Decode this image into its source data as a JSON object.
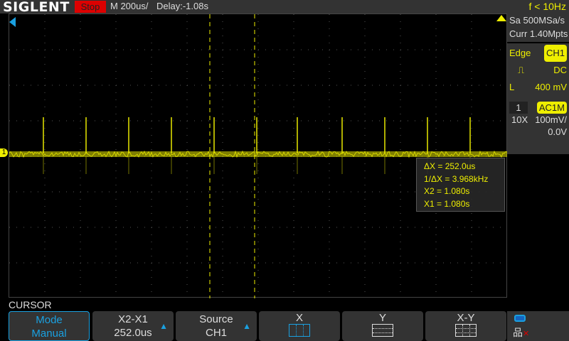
{
  "header": {
    "logo": "SIGLENT",
    "status": "Stop",
    "timebase": "M 200us/",
    "delay": "Delay:-1.08s",
    "trigger_freq": "f < 10Hz"
  },
  "acquisition": {
    "sample_rate": "Sa 500MSa/s",
    "memory": "Curr 1.40Mpts"
  },
  "trigger": {
    "type": "Edge",
    "source": "CH1",
    "coupling": "DC",
    "level_label": "L",
    "level": "400 mV"
  },
  "channel": {
    "number": "1",
    "coupling": "AC1M",
    "probe": "10X",
    "scale": "100mV/",
    "offset": "0.0V"
  },
  "measurement": {
    "delta_x": "ΔX = 252.0us",
    "inv_delta_x": "1/ΔX = 3.968kHz",
    "x2": "X2 = 1.080s",
    "x1": "X1 = 1.080s"
  },
  "menu": {
    "title": "CURSOR",
    "buttons": [
      {
        "top": "Mode",
        "bottom": "Manual"
      },
      {
        "top": "X2-X1",
        "bottom": "252.0us"
      },
      {
        "top": "Source",
        "bottom": "CH1"
      },
      {
        "top": "X"
      },
      {
        "top": "Y"
      },
      {
        "top": "X-Y"
      }
    ]
  },
  "colors": {
    "trace": "#e8e800",
    "accent": "#1aa0e0",
    "stop": "#dd0000"
  }
}
